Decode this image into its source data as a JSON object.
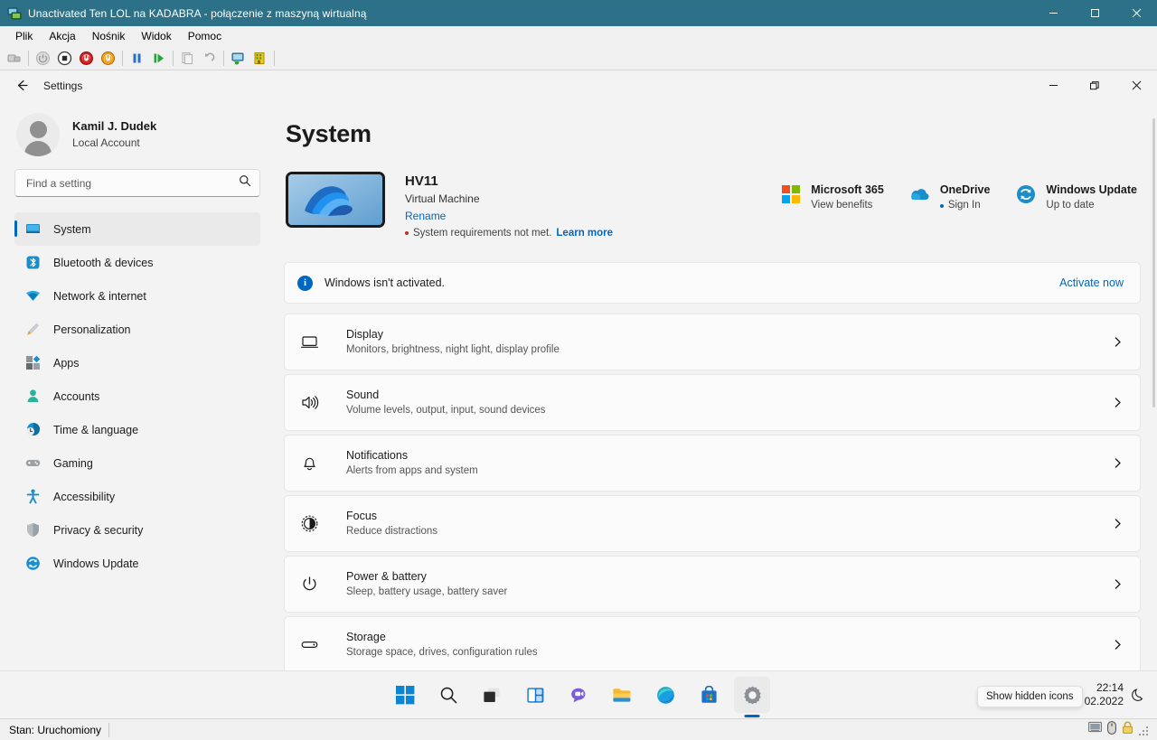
{
  "vmm": {
    "title": "Unactivated Ten LOL na KADABRA - połączenie z maszyną wirtualną",
    "icon": "virtual-machine-icon",
    "menus": [
      "Plik",
      "Akcja",
      "Nośnik",
      "Widok",
      "Pomoc"
    ],
    "toolbar": [
      {
        "name": "ctrl-alt-del-button",
        "label": "Ctrl+Alt+Delete"
      },
      {
        "name": "start-button",
        "label": "Uruchom"
      },
      {
        "name": "turn-off-button",
        "label": "Wyłącz"
      },
      {
        "name": "shut-down-button",
        "label": "Zamknij"
      },
      {
        "name": "reset-button",
        "label": "Resetuj"
      },
      {
        "name": "pause-button",
        "label": "Wstrzymaj"
      },
      {
        "name": "resume-button",
        "label": "Wznów"
      },
      {
        "name": "checkpoint-button",
        "label": "Punkt kontrolny"
      },
      {
        "name": "revert-button",
        "label": "Cofnij"
      },
      {
        "name": "enhanced-session-button",
        "label": "Sesja rozszerzona"
      },
      {
        "name": "settings-button",
        "label": "Ustawienia"
      }
    ],
    "window_controls": {
      "minimize": "minimize-button",
      "maximize": "maximize-button",
      "close": "close-button"
    },
    "status": "Stan: Uruchomiony"
  },
  "settings": {
    "titlebar": {
      "back": "back-button",
      "title": "Settings"
    },
    "account": {
      "name": "Kamil J. Dudek",
      "type": "Local Account"
    },
    "search": {
      "placeholder": "Find a setting",
      "value": ""
    },
    "nav": [
      {
        "label": "System",
        "icon": "monitor-icon",
        "selected": true
      },
      {
        "label": "Bluetooth & devices",
        "icon": "bluetooth-icon",
        "selected": false
      },
      {
        "label": "Network & internet",
        "icon": "wifi-icon",
        "selected": false
      },
      {
        "label": "Personalization",
        "icon": "paintbrush-icon",
        "selected": false
      },
      {
        "label": "Apps",
        "icon": "apps-icon",
        "selected": false
      },
      {
        "label": "Accounts",
        "icon": "person-icon",
        "selected": false
      },
      {
        "label": "Time & language",
        "icon": "clock-globe-icon",
        "selected": false
      },
      {
        "label": "Gaming",
        "icon": "gamepad-icon",
        "selected": false
      },
      {
        "label": "Accessibility",
        "icon": "accessibility-icon",
        "selected": false
      },
      {
        "label": "Privacy & security",
        "icon": "shield-icon",
        "selected": false
      },
      {
        "label": "Windows Update",
        "icon": "update-icon",
        "selected": false
      }
    ],
    "page_title": "System",
    "device": {
      "name": "HV11",
      "model": "Virtual Machine",
      "rename_link": "Rename",
      "warning_text": "System requirements not met.",
      "warning_link": "Learn more"
    },
    "services": [
      {
        "title": "Microsoft 365",
        "sub": "View benefits",
        "icon": "microsoft-365-icon",
        "bullet": false
      },
      {
        "title": "OneDrive",
        "sub": "Sign In",
        "icon": "onedrive-icon",
        "bullet": true
      },
      {
        "title": "Windows Update",
        "sub": "Up to date",
        "icon": "update-icon",
        "bullet": false
      }
    ],
    "banner": {
      "text": "Windows isn't activated.",
      "action": "Activate now",
      "icon": "info-icon"
    },
    "rows": [
      {
        "title": "Display",
        "sub": "Monitors, brightness, night light, display profile",
        "icon": "display-icon"
      },
      {
        "title": "Sound",
        "sub": "Volume levels, output, input, sound devices",
        "icon": "speaker-icon"
      },
      {
        "title": "Notifications",
        "sub": "Alerts from apps and system",
        "icon": "bell-icon"
      },
      {
        "title": "Focus",
        "sub": "Reduce distractions",
        "icon": "focus-icon"
      },
      {
        "title": "Power & battery",
        "sub": "Sleep, battery usage, battery saver",
        "icon": "power-icon"
      },
      {
        "title": "Storage",
        "sub": "Storage space, drives, configuration rules",
        "icon": "storage-icon"
      }
    ]
  },
  "taskbar": {
    "apps": [
      {
        "name": "start-button",
        "icon": "windows-logo-icon"
      },
      {
        "name": "search-button",
        "icon": "search-icon"
      },
      {
        "name": "task-view-button",
        "icon": "task-view-icon"
      },
      {
        "name": "widgets-button",
        "icon": "widgets-icon"
      },
      {
        "name": "chat-button",
        "icon": "chat-icon"
      },
      {
        "name": "file-explorer-button",
        "icon": "folder-icon"
      },
      {
        "name": "edge-button",
        "icon": "edge-icon"
      },
      {
        "name": "store-button",
        "icon": "store-icon"
      },
      {
        "name": "settings-taskbar-button",
        "icon": "gear-icon",
        "active": true
      }
    ],
    "tray": {
      "chevron": "⌃",
      "icons": [
        "network-icon",
        "volume-icon",
        "battery-icon"
      ],
      "tooltip": "Show hidden icons",
      "time": "22:14",
      "date": "02.2022",
      "moon": "notification-moon-icon"
    }
  }
}
